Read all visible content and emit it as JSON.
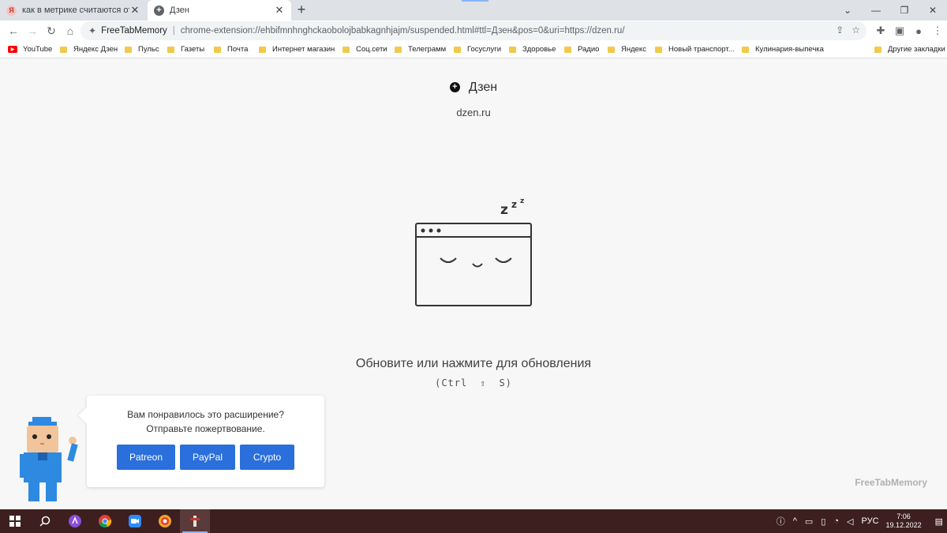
{
  "browser": {
    "tabs": [
      {
        "title": "как в метрике считаются отказ",
        "favicon": "yandex-favicon",
        "active": false
      },
      {
        "title": "Дзен",
        "favicon": "dzen-favicon",
        "active": true
      }
    ],
    "omnibox": {
      "extension_name": "FreeTabMemory",
      "url": "chrome-extension://ehbifmnhnghckaobolojbabkagnhjajm/suspended.html#ttl=Дзен&pos=0&uri=https://dzen.ru/"
    },
    "bookmarks": [
      {
        "label": "YouTube",
        "icon": "youtube-icon"
      },
      {
        "label": "Яндекс Дзен",
        "icon": "folder-icon"
      },
      {
        "label": "Пульс",
        "icon": "folder-icon"
      },
      {
        "label": "Газеты",
        "icon": "folder-icon"
      },
      {
        "label": "Почта",
        "icon": "folder-icon"
      },
      {
        "label": "Интернет магазин",
        "icon": "folder-icon"
      },
      {
        "label": "Соц.сети",
        "icon": "folder-icon"
      },
      {
        "label": "Телеграмм",
        "icon": "folder-icon"
      },
      {
        "label": "Госуслуги",
        "icon": "folder-icon"
      },
      {
        "label": "Здоровье",
        "icon": "folder-icon"
      },
      {
        "label": "Радио",
        "icon": "folder-icon"
      },
      {
        "label": "Яндекс",
        "icon": "folder-icon"
      },
      {
        "label": "Новый транспорт...",
        "icon": "folder-icon"
      },
      {
        "label": "Кулинария-выпечка",
        "icon": "folder-icon"
      },
      {
        "label": "Другие закладки",
        "icon": "folder-icon"
      }
    ]
  },
  "page": {
    "title": "Дзен",
    "url": "dzen.ru",
    "sleep_zs": [
      "z",
      "z",
      "z"
    ],
    "reload_text": "Обновите или нажмите для обновления",
    "shortcut": {
      "open": "(Ctrl",
      "shift": "⇧",
      "key": "S)"
    }
  },
  "donate": {
    "line1": "Вам понравилось это расширение?",
    "line2": "Отправьте пожертвование.",
    "buttons": [
      "Patreon",
      "PayPal",
      "Crypto"
    ],
    "button_color": "#2a6fdb"
  },
  "brand": "FreeTabMemory",
  "taskbar": {
    "language": "РУС",
    "time": "7:06",
    "date": "19.12.2022",
    "apps": [
      "windows-start-icon",
      "search-icon",
      "alice-icon",
      "chrome-icon",
      "zoom-icon",
      "yandex-browser-icon",
      "active-app-icon"
    ]
  }
}
